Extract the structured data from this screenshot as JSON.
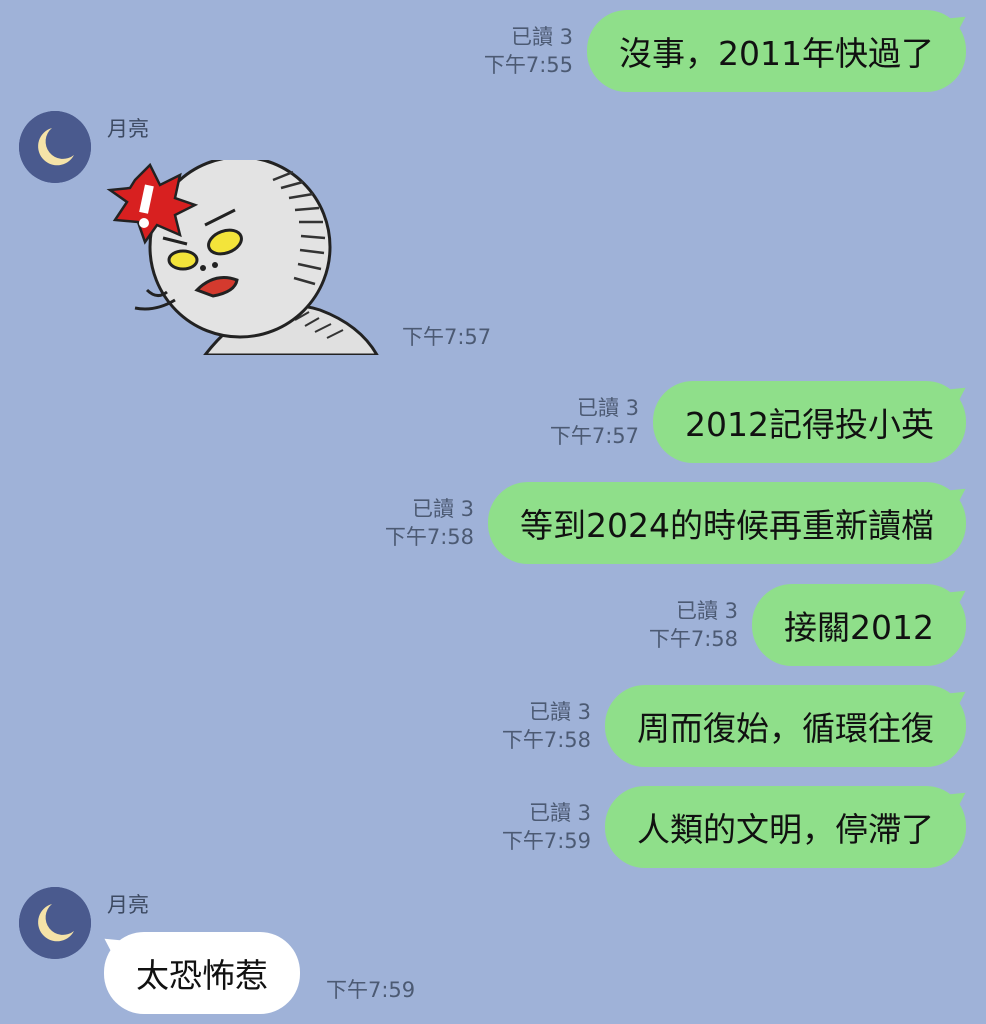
{
  "messages": [
    {
      "id": "m1",
      "read": "已讀 3",
      "time": "下午7:55",
      "text": "沒事，2011年快過了"
    },
    {
      "id": "m3",
      "read": "已讀 3",
      "time": "下午7:57",
      "text": "2012記得投小英"
    },
    {
      "id": "m4",
      "read": "已讀 3",
      "time": "下午7:58",
      "text": "等到2024的時候再重新讀檔"
    },
    {
      "id": "m5",
      "read": "已讀 3",
      "time": "下午7:58",
      "text": "接關2012"
    },
    {
      "id": "m6",
      "read": "已讀 3",
      "time": "下午7:58",
      "text": "周而復始，循環往復"
    },
    {
      "id": "m7",
      "read": "已讀 3",
      "time": "下午7:59",
      "text": "人類的文明，停滯了"
    }
  ],
  "incoming": [
    {
      "id": "in1",
      "sender": "月亮",
      "time": "下午7:57",
      "type": "sticker",
      "sticker_name": "angry-moon-exclamation-sticker"
    },
    {
      "id": "in2",
      "sender": "月亮",
      "time": "下午7:59",
      "type": "text",
      "text": "太恐怖惹"
    }
  ],
  "colors": {
    "background": "#9fb2d8",
    "outgoing_bubble": "#8fdf8a",
    "incoming_bubble": "#ffffff",
    "avatar_bg": "#4a5a8e",
    "moon": "#f5e3a8"
  }
}
